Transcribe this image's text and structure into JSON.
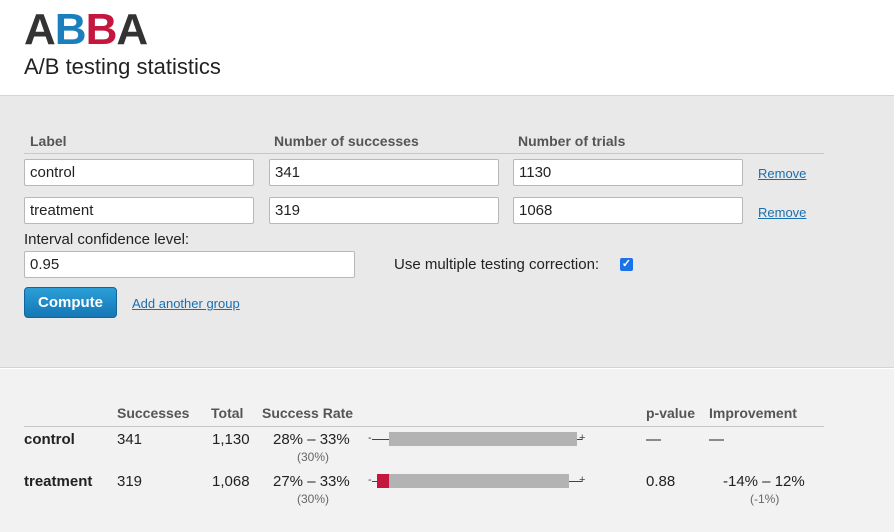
{
  "header": {
    "logo_letters": [
      "A",
      "B",
      "B",
      "A"
    ],
    "subtitle": "A/B testing statistics"
  },
  "form": {
    "col_label": "Label",
    "col_successes": "Number of successes",
    "col_trials": "Number of trials",
    "rows": [
      {
        "label": "control",
        "successes": "341",
        "trials": "1130",
        "remove": "Remove"
      },
      {
        "label": "treatment",
        "successes": "319",
        "trials": "1068",
        "remove": "Remove"
      }
    ],
    "confidence_label": "Interval confidence level:",
    "confidence_value": "0.95",
    "mtc_label": "Use multiple testing correction:",
    "mtc_checked": true,
    "compute_label": "Compute",
    "add_group_label": "Add another group"
  },
  "results": {
    "headers": {
      "successes": "Successes",
      "total": "Total",
      "rate": "Success Rate",
      "pvalue": "p-value",
      "improvement": "Improvement"
    },
    "rows": [
      {
        "label": "control",
        "successes": "341",
        "total": "1,130",
        "rate_range": "28% – 33%",
        "rate_point": "(30%)",
        "pvalue": "—",
        "improvement": "—",
        "improvement_point": ""
      },
      {
        "label": "treatment",
        "successes": "319",
        "total": "1,068",
        "rate_range": "27% – 33%",
        "rate_point": "(30%)",
        "pvalue": "0.88",
        "improvement": "-14% – 12%",
        "improvement_point": "(-1%)"
      }
    ],
    "interval_minus_glyph": "-",
    "interval_plus_glyph": "+"
  },
  "colors": {
    "accent_blue": "#1b7fbd",
    "accent_red": "#c5163f",
    "dark": "#333333"
  }
}
